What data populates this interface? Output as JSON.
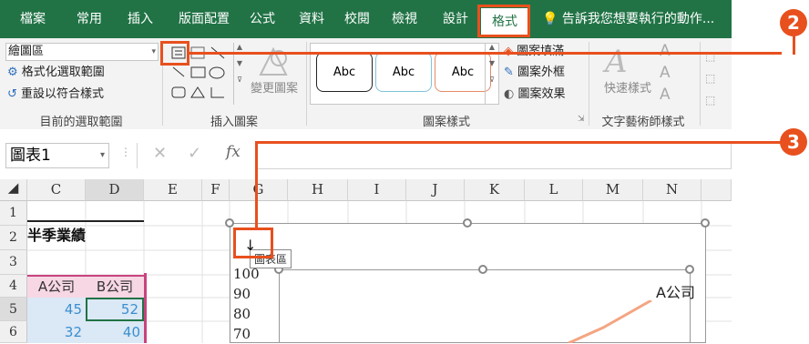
{
  "ribbon": {
    "tabs": [
      "檔案",
      "常用",
      "插入",
      "版面配置",
      "公式",
      "資料",
      "校閱",
      "檢視",
      "設計",
      "格式"
    ],
    "active_tab": "格式",
    "tell_me": "告訴我您想要執行的動作..."
  },
  "current_selection": {
    "dropdown_value": "繪圖區",
    "format_selection": "格式化選取範圍",
    "reset_to_match_style": "重設以符合樣式",
    "group_label": "目前的選取範圍"
  },
  "insert_shapes": {
    "change_shape": "變更圖案",
    "group_label": "插入圖案"
  },
  "shape_styles": {
    "preset_label": "Abc",
    "fill": "圖案填滿",
    "outline": "圖案外框",
    "effects": "圖案效果",
    "group_label": "圖案樣式"
  },
  "wordart": {
    "quick_styles": "快速樣式",
    "text_sample": "A",
    "group_label": "文字藝術師樣式"
  },
  "formula_bar": {
    "name_box": "圖表1",
    "fx": "fx"
  },
  "sheet": {
    "columns": [
      "C",
      "D",
      "E",
      "F",
      "G",
      "H",
      "I",
      "J",
      "K",
      "L",
      "M",
      "N"
    ],
    "rows": [
      "1",
      "2",
      "3",
      "4",
      "5",
      "6"
    ],
    "title_cell": "半季業績",
    "header_a": "A公司",
    "header_b": "B公司",
    "row5": [
      "45",
      "52"
    ],
    "row6": [
      "32",
      "40"
    ]
  },
  "chart": {
    "tooltip": "圖表區",
    "y_ticks": [
      "100",
      "90",
      "80",
      "70"
    ],
    "series_label": "A公司",
    "series_color": "#f4a582"
  },
  "callouts": [
    "2",
    "3"
  ],
  "colors": {
    "excel_green": "#217346",
    "callout_orange": "#e8501e",
    "selection_green": "#217346"
  }
}
